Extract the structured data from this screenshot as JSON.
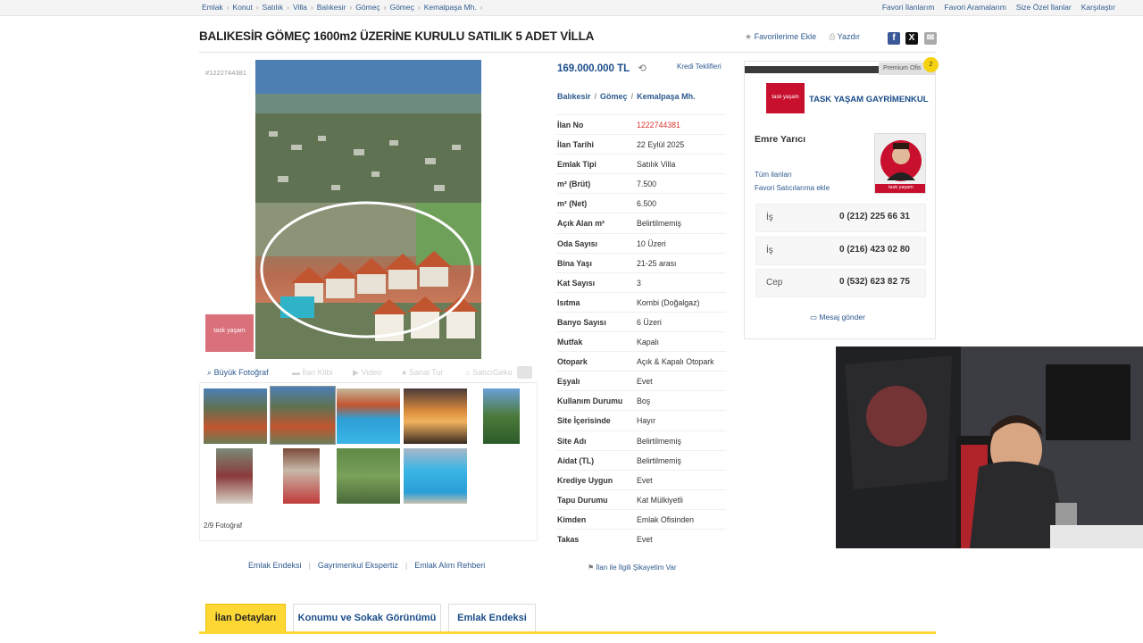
{
  "breadcrumb": {
    "items": [
      "Emlak",
      "Konut",
      "Satılık",
      "Villa",
      "Balıkesir",
      "Gömeç",
      "Gömeç",
      "Kemalpaşa Mh."
    ],
    "separator": "›"
  },
  "top_links": [
    "Favori İlanlarım",
    "Favori Aramalarım",
    "Size Özel İlanlar",
    "Karşılaştır"
  ],
  "listing": {
    "title": "BALIKESİR GÖMEÇ 1600m2 ÜZERİNE KURULU SATILIK 5 ADET VİLLA",
    "id_label": "#1222744381",
    "favorite_label": "Favorilerime Ekle",
    "print_label": "Yazdır",
    "price": "169.000.000 TL",
    "credit_link": "Kredi Teklifleri",
    "location": [
      "Balıkesir",
      "Gömeç",
      "Kemalpaşa Mh."
    ],
    "location_sep": "/"
  },
  "gallery": {
    "logo_text": "task yaşam",
    "tabs": [
      "Büyük Fotoğraf",
      "İlan Klibi",
      "Video",
      "Sanal Tur",
      "SatıcıGeko"
    ],
    "photo_count": "2/9 Fotoğraf"
  },
  "details": [
    {
      "key": "İlan No",
      "value": "1222744381",
      "highlight": true
    },
    {
      "key": "İlan Tarihi",
      "value": "22 Eylül 2025"
    },
    {
      "key": "Emlak Tipi",
      "value": "Satılık Villa"
    },
    {
      "key": "m² (Brüt)",
      "value": "7.500"
    },
    {
      "key": "m² (Net)",
      "value": "6.500"
    },
    {
      "key": "Açık Alan m²",
      "value": "Belirtilmemiş"
    },
    {
      "key": "Oda Sayısı",
      "value": "10 Üzeri"
    },
    {
      "key": "Bina Yaşı",
      "value": "21-25 arası"
    },
    {
      "key": "Kat Sayısı",
      "value": "3"
    },
    {
      "key": "Isıtma",
      "value": "Kombi (Doğalgaz)"
    },
    {
      "key": "Banyo Sayısı",
      "value": "6 Üzeri"
    },
    {
      "key": "Mutfak",
      "value": "Kapalı"
    },
    {
      "key": "Otopark",
      "value": "Açık & Kapalı Otopark"
    },
    {
      "key": "Eşyalı",
      "value": "Evet"
    },
    {
      "key": "Kullanım Durumu",
      "value": "Boş"
    },
    {
      "key": "Site İçerisinde",
      "value": "Hayır"
    },
    {
      "key": "Site Adı",
      "value": "Belirtilmemiş"
    },
    {
      "key": "Aidat (TL)",
      "value": "Belirtilmemiş"
    },
    {
      "key": "Krediye Uygun",
      "value": "Evet"
    },
    {
      "key": "Tapu Durumu",
      "value": "Kat Mülkiyetli"
    },
    {
      "key": "Kimden",
      "value": "Emlak Ofisinden"
    },
    {
      "key": "Takas",
      "value": "Evet"
    }
  ],
  "complaint_link": "İlan ile İlgili Şikayetim Var",
  "bottom_links": [
    "Emlak Endeksi",
    "Gayrimenkul Ekspertiz",
    "Emlak Alım Rehberi"
  ],
  "seller": {
    "premium_label": "Premium Ofis",
    "badge": "2",
    "office_logo": "task yaşam",
    "office_name": "TASK YAŞAM GAYRİMENKUL",
    "agent_name": "Emre Yarıcı",
    "agent_photo_label": "task yaşam",
    "all_ads": "Tüm ilanları",
    "fav_seller": "Favori Satıcılarıma ekle",
    "phones": [
      {
        "label": "İş",
        "number": "0 (212) 225 66 31"
      },
      {
        "label": "İş",
        "number": "0 (216) 423 02 80"
      },
      {
        "label": "Cep",
        "number": "0 (532) 623 82 75"
      }
    ],
    "message": "Mesaj gönder"
  },
  "tabs": [
    "İlan Detayları",
    "Konumu ve Sokak Görünümü",
    "Emlak Endeksi"
  ],
  "colors": {
    "accent_yellow": "#fdd835",
    "link_blue": "#2e5a8f",
    "id_red": "#d9332f"
  }
}
